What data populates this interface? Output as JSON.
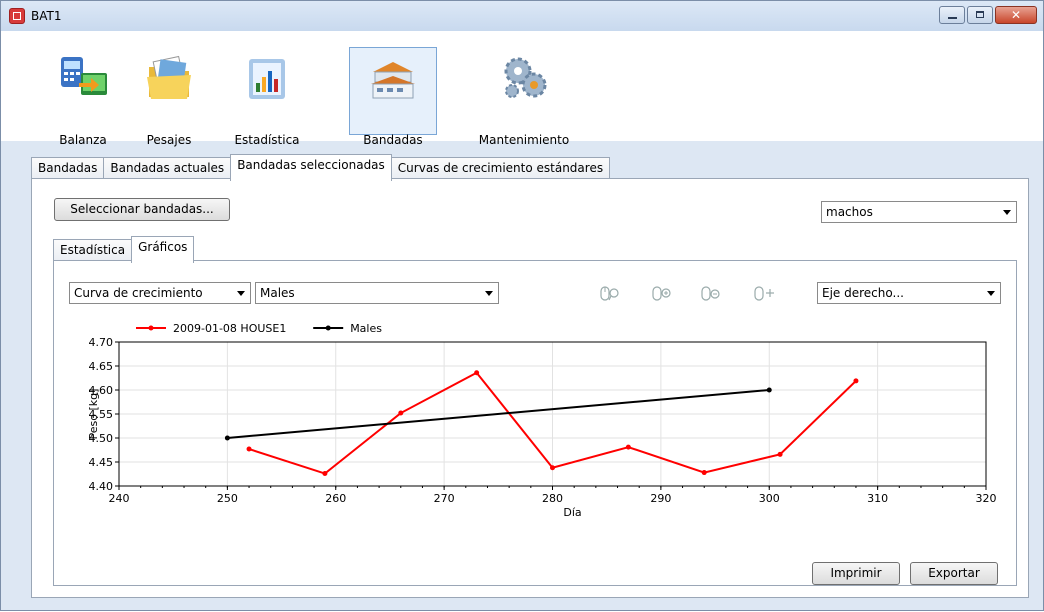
{
  "window": {
    "title": "BAT1"
  },
  "toolbar": {
    "items": [
      {
        "label": "Balanza",
        "icon": "scale-icon"
      },
      {
        "label": "Pesajes",
        "icon": "folder-icon"
      },
      {
        "label": "Estadística",
        "icon": "statistics-icon"
      },
      {
        "label": "Bandadas",
        "icon": "barn-icon",
        "active": true
      },
      {
        "label": "Mantenimiento",
        "icon": "gears-icon"
      }
    ]
  },
  "main_tabs": [
    {
      "label": "Bandadas"
    },
    {
      "label": "Bandadas actuales"
    },
    {
      "label": "Bandadas seleccionadas",
      "selected": true
    },
    {
      "label": "Curvas de crecimiento estándares"
    }
  ],
  "select_flocks_button": "Seleccionar bandadas...",
  "sex_select": {
    "value": "machos"
  },
  "sub_tabs": [
    {
      "label": "Estadística"
    },
    {
      "label": "Gráficos",
      "selected": true
    }
  ],
  "chart_type_select": {
    "value": "Curva de crecimiento"
  },
  "curve_select": {
    "value": "Males"
  },
  "right_axis_select": {
    "value": "Eje derecho..."
  },
  "chart_tools": [
    "zoom-y-icon",
    "zoom-in-icon",
    "zoom-out-icon",
    "pan-icon"
  ],
  "buttons": {
    "print": "Imprimir",
    "export": "Exportar"
  },
  "chart_data": {
    "type": "line",
    "xlabel": "Día",
    "ylabel": "Peso [kg]",
    "xlim": [
      240,
      320
    ],
    "ylim": [
      4.4,
      4.7
    ],
    "xticks": [
      "240",
      "250",
      "260",
      "270",
      "280",
      "290",
      "300",
      "310",
      "320"
    ],
    "yticks": [
      "4.40",
      "4.45",
      "4.50",
      "4.55",
      "4.60",
      "4.65",
      "4.70"
    ],
    "grid": true,
    "legend": "top",
    "series": [
      {
        "name": "2009-01-08 HOUSE1",
        "color": "#ff0000",
        "x": [
          252,
          259,
          266,
          273,
          280,
          287,
          294,
          301,
          308
        ],
        "y": [
          4.477,
          4.426,
          4.552,
          4.636,
          4.438,
          4.481,
          4.428,
          4.466,
          4.619
        ]
      },
      {
        "name": "Males",
        "color": "#000000",
        "x": [
          250,
          300
        ],
        "y": [
          4.5,
          4.6
        ]
      }
    ]
  }
}
